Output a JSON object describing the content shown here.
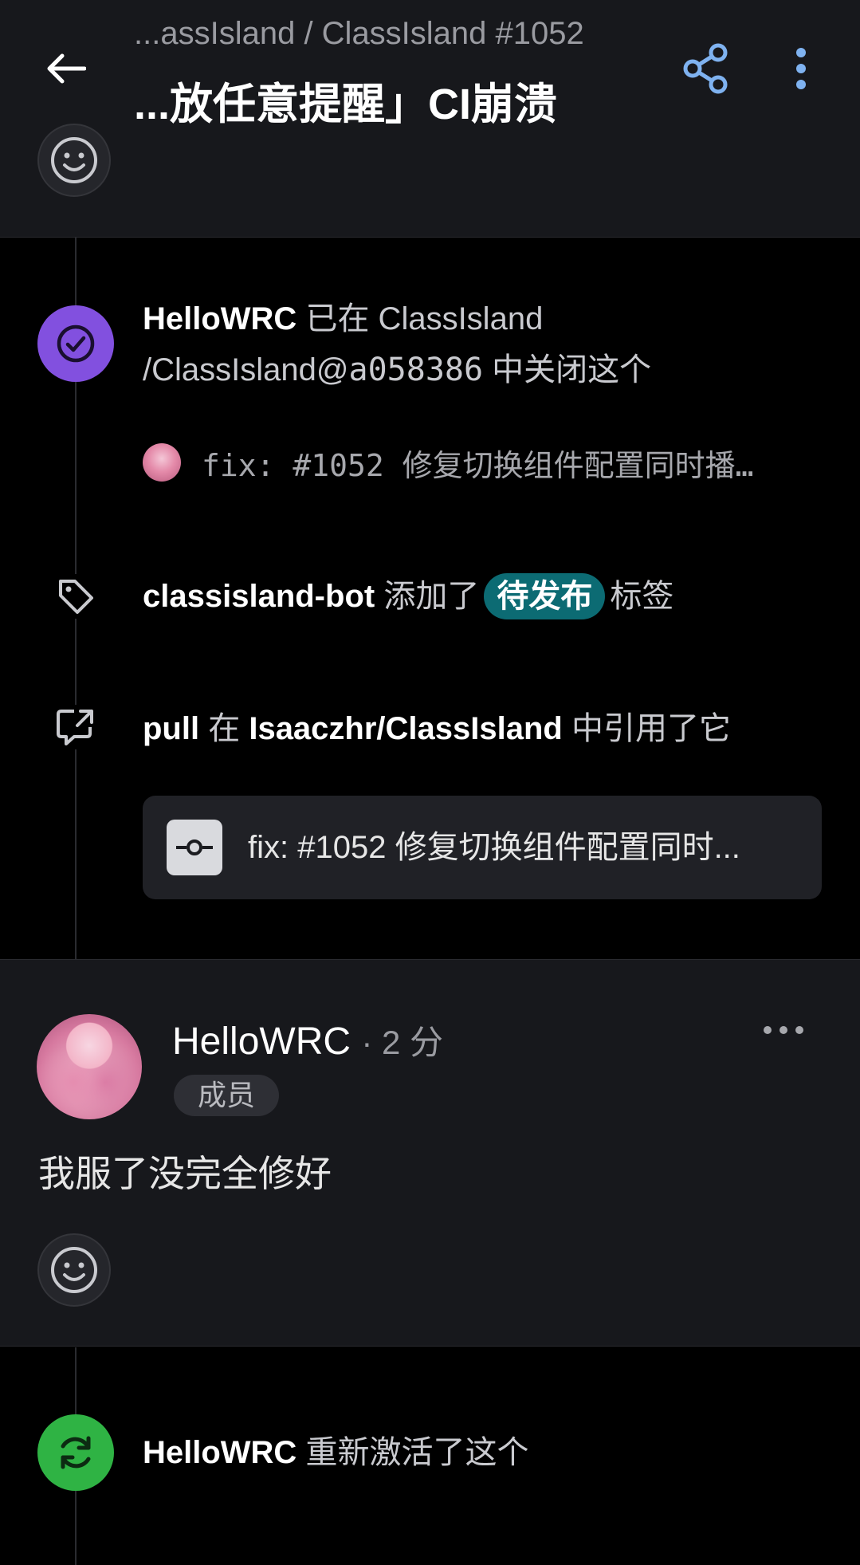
{
  "header": {
    "breadcrumb": "...assIsland / ClassIsland #1052",
    "title": "...放任意提醒」CI崩溃"
  },
  "events": {
    "closed": {
      "actor": "HelloWRC",
      "text_before": " 已在 ClassIsland /ClassIsland@",
      "commit_ref": "a058386",
      "text_after": " 中关闭这个",
      "commit_message": "fix: #1052 修复切换组件配置同时播…"
    },
    "labeled": {
      "actor": "classisland-bot",
      "text_before": " 添加了",
      "label": "待发布",
      "text_after": "标签"
    },
    "referenced": {
      "actor": "pull",
      "text_mid": " 在 ",
      "repo": "Isaaczhr/ClassIsland",
      "text_after": " 中引用了它",
      "pr_title": "fix: #1052 修复切换组件配置同时..."
    },
    "reopened": {
      "actor": "HelloWRC",
      "text": " 重新激活了这个"
    }
  },
  "comment": {
    "author": "HelloWRC",
    "time": "· 2 分",
    "role": "成员",
    "body": "我服了没完全修好"
  },
  "colors": {
    "accent_blue": "#7fb2f0",
    "closed_purple": "#8250df",
    "reopen_green": "#2fb344",
    "label_teal": "#0c6b73"
  }
}
